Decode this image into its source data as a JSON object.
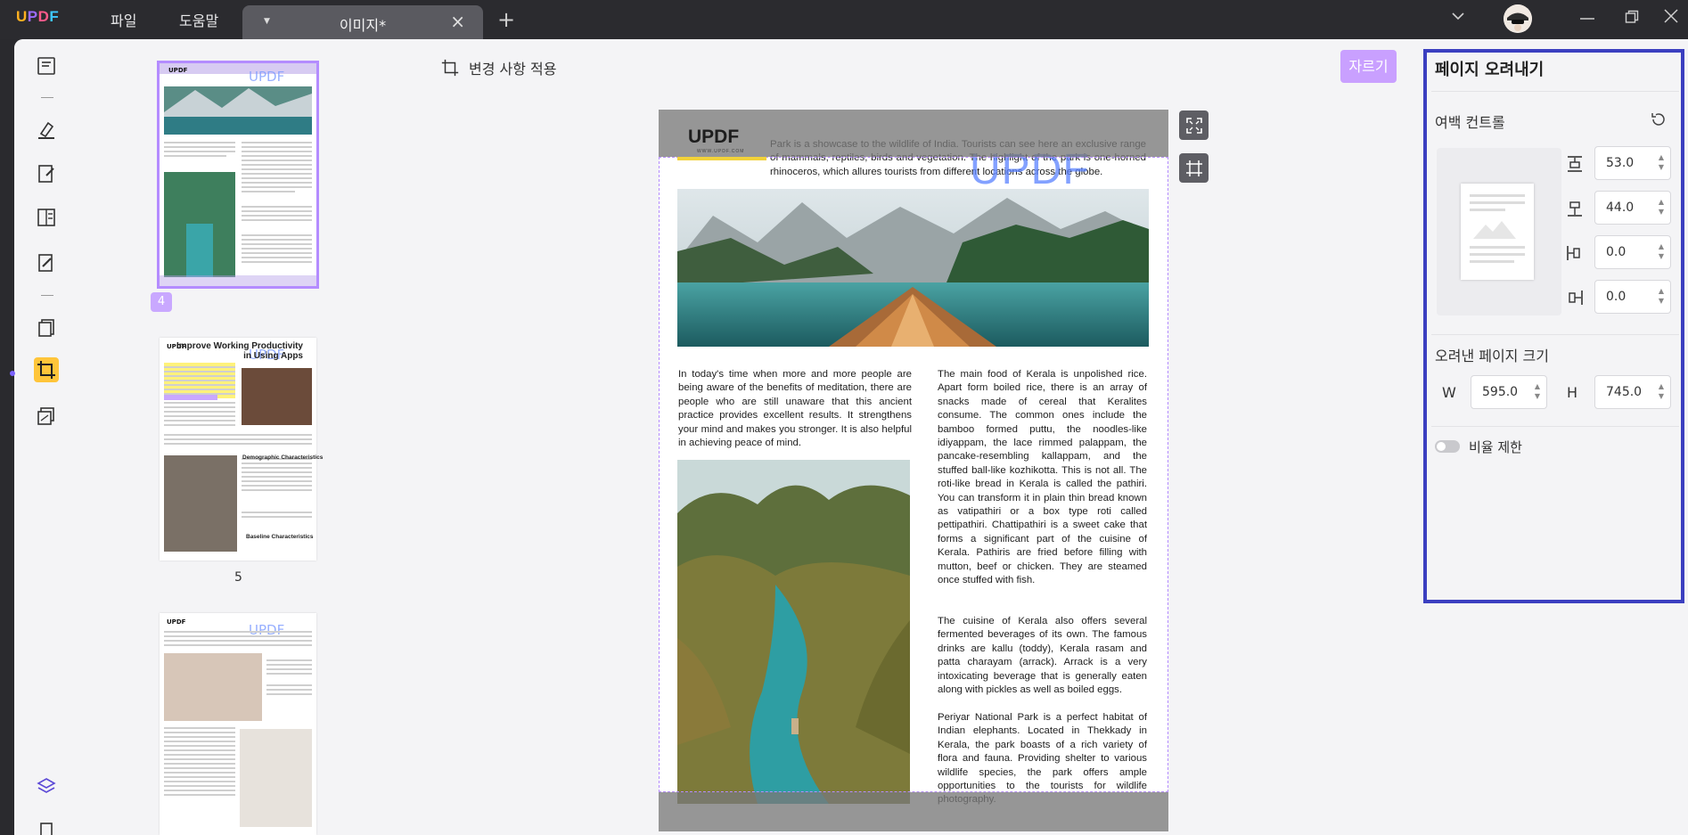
{
  "app": {
    "logo_text": "UPDF",
    "menu": [
      "파일",
      "도움말"
    ],
    "tab_title": "이미지*"
  },
  "thumbnails": {
    "pages": [
      {
        "label": "4",
        "heading": "",
        "selected": true
      },
      {
        "label": "5",
        "heading": "Improve Working Productivity in Using Apps",
        "selected": false
      },
      {
        "label": "",
        "heading": "",
        "selected": false
      }
    ],
    "demographic_heading": "Demographic Characteristics",
    "baseline_heading": "Baseline Characteristics"
  },
  "toolbar": {
    "apply_changes": "변경 사항 적용",
    "crop_button": "자르기"
  },
  "document": {
    "watermark": "UPDF",
    "logo_text": "UPDF",
    "logo_url": "WWW.UPDF.COM",
    "intro": "Park is a showcase to the wildlife of India. Tourists can see here an exclusive range of mammals, reptiles, birds and vegetation. The highlight of the park is one-horned rhinoceros, which allures tourists from different locations across the globe.",
    "left_column": "In today's time when more and more people are being aware of the benefits of meditation, there are people who are still unaware that this ancient practice provides excellent results. It strengthens your mind and makes you stronger. It is also helpful in achieving peace of mind.",
    "right_column_1": "The main food of Kerala is unpolished rice. Apart form boiled rice, there is an array of snacks made of cereal that Keralites consume. The common ones include the bamboo formed puttu, the noodles-like idiyappam, the lace rimmed palappam, the pancake-resembling kallappam, and the stuffed ball-like kozhikotta. This is not all. The roti-like bread in Kerala is called the pathiri. You can transform it in plain thin bread known as vatipathiri or a box type roti called pettipathiri. Chattipathiri is a sweet cake that forms a significant part of the cuisine of Kerala. Pathiris are fried before filling with mutton, beef or chicken. They are steamed once stuffed with fish.",
    "right_column_2": "The cuisine of Kerala also offers several fermented beverages of its own. The famous drinks are kallu (toddy), Kerala rasam and patta charayam (arrack). Arrack is a very intoxicating beverage that is generally eaten along with pickles as well as boiled eggs.",
    "right_column_3": "Periyar National Park is a perfect habitat of Indian elephants. Located in Thekkady in Kerala, the park boasts of a rich variety of flora and fauna. Providing shelter to various wildlife species, the park offers ample opportunities to the tourists for wildlife photography."
  },
  "panel": {
    "title": "페이지 오려내기",
    "margin_control": "여백 컨트롤",
    "margins": {
      "top": "53.0",
      "bottom": "44.0",
      "left": "0.0",
      "right": "0.0"
    },
    "cropped_size_label": "오려낸 페이지 크기",
    "width_label": "W",
    "width_value": "595.0",
    "height_label": "H",
    "height_value": "745.0",
    "ratio_lock_label": "비율 제한",
    "ratio_lock_on": false
  },
  "colors": {
    "accent": "#b48cff",
    "crop_button": "#c9a0ff",
    "panel_highlight": "#3b3fc0",
    "active_tool": "#ffc53a"
  }
}
